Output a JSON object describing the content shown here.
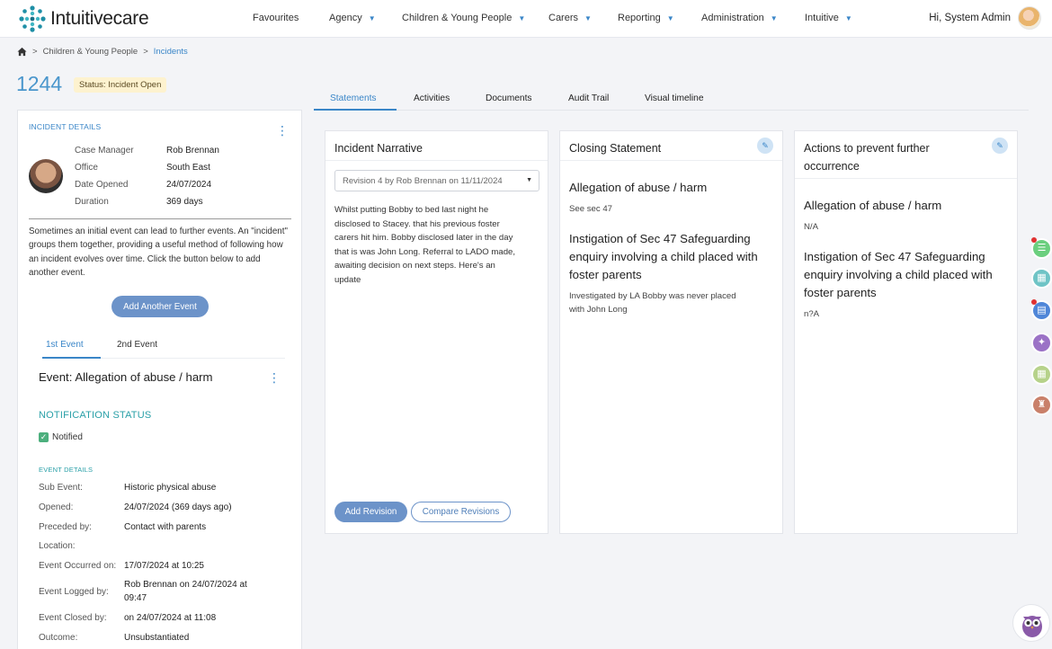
{
  "brand": {
    "name": "Intuitivecare"
  },
  "nav": [
    {
      "label": "Favourites",
      "has_menu": false
    },
    {
      "label": "Agency",
      "has_menu": true
    },
    {
      "label": "Children & Young People",
      "has_menu": true
    },
    {
      "label": "Carers",
      "has_menu": true
    },
    {
      "label": "Reporting",
      "has_menu": true
    },
    {
      "label": "Administration",
      "has_menu": true
    },
    {
      "label": "Intuitive",
      "has_menu": true
    }
  ],
  "user": {
    "greeting": "Hi, System Admin"
  },
  "breadcrumb": {
    "section": "Children & Young People",
    "current": "Incidents",
    "separator": ">"
  },
  "record": {
    "id": "1244",
    "status": "Status: Incident Open"
  },
  "incident_details": {
    "title": "INCIDENT DETAILS",
    "fields": [
      {
        "label": "Case Manager",
        "value": "Rob Brennan"
      },
      {
        "label": "Office",
        "value": "South East"
      },
      {
        "label": "Date Opened",
        "value": "24/07/2024"
      },
      {
        "label": "Duration",
        "value": "369 days"
      }
    ],
    "description": "Sometimes an initial event can lead to further events. An \"incident\" groups them together, providing a useful method of following how an incident evolves over time. Click the button below to add another event.",
    "add_event_label": "Add Another Event"
  },
  "event_tabs": [
    {
      "label": "1st Event",
      "active": true
    },
    {
      "label": "2nd Event",
      "active": false
    }
  ],
  "event": {
    "title": "Event: Allegation of abuse / harm",
    "notification_heading": "NOTIFICATION STATUS",
    "notified_label": "Notified",
    "notified": true,
    "details_heading": "EVENT DETAILS",
    "rows": [
      {
        "label": "Sub Event:",
        "value": "Historic physical abuse"
      },
      {
        "label": "Opened:",
        "value": "24/07/2024 (369 days ago)"
      },
      {
        "label": "Preceded by:",
        "value": "Contact with parents"
      },
      {
        "label": "Location:",
        "value": ""
      },
      {
        "label": "Event Occurred on:",
        "value": "17/07/2024 at 10:25"
      },
      {
        "label": "Event Logged by:",
        "value": "Rob Brennan on 24/07/2024 at",
        "value2": "09:47"
      },
      {
        "label": "Event Closed by:",
        "value": "on 24/07/2024 at 11:08"
      },
      {
        "label": "Outcome:",
        "value": "Unsubstantiated"
      }
    ]
  },
  "main_tabs": [
    {
      "label": "Statements",
      "active": true
    },
    {
      "label": "Activities",
      "active": false
    },
    {
      "label": "Documents",
      "active": false
    },
    {
      "label": "Audit Trail",
      "active": false
    },
    {
      "label": "Visual timeline",
      "active": false
    }
  ],
  "narrative": {
    "title": "Incident Narrative",
    "revision_selected": "Revision 4 by Rob Brennan on 11/11/2024",
    "lines": [
      "Whilst putting Bobby to bed last night he",
      "disclosed to Stacey. that his previous foster",
      "carers hit him.  Bobby disclosed later in the day",
      "that is was John Long. Referral to LADO made,",
      "awaiting decision on next steps. Here's an",
      "update"
    ],
    "add_revision_label": "Add Revision",
    "compare_label": "Compare Revisions"
  },
  "closing": {
    "title": "Closing Statement",
    "sections": [
      {
        "heading": [
          "Allegation of abuse / harm"
        ],
        "text": [
          "See sec 47"
        ]
      },
      {
        "heading": [
          "Instigation of Sec 47 Safeguarding",
          "enquiry involving a child placed with",
          "foster parents"
        ],
        "text": [
          "Investigated by LA Bobby was never placed",
          "with John Long"
        ]
      }
    ]
  },
  "actions": {
    "title_lines": [
      "Actions to prevent further",
      "occurrence"
    ],
    "sections": [
      {
        "heading": [
          "Allegation of abuse / harm"
        ],
        "text": [
          "N/A"
        ]
      },
      {
        "heading": [
          "Instigation of Sec 47 Safeguarding",
          "enquiry involving a child placed with",
          "foster parents"
        ],
        "text": [
          "n?A"
        ]
      }
    ]
  },
  "side_icons": [
    {
      "name": "list-icon",
      "glyph": "☰",
      "color": "#6bcf7e",
      "badge": true
    },
    {
      "name": "building-icon",
      "glyph": "▦",
      "color": "#6fc4c6",
      "badge": false
    },
    {
      "name": "document-icon",
      "glyph": "▤",
      "color": "#4f86d8",
      "badge": true
    },
    {
      "name": "person-icon",
      "glyph": "✦",
      "color": "#9b72c6",
      "badge": false
    },
    {
      "name": "calendar-icon",
      "glyph": "▦",
      "color": "#b6d28a",
      "badge": false
    },
    {
      "name": "stamp-icon",
      "glyph": "♜",
      "color": "#c9806a",
      "badge": false
    }
  ],
  "colors": {
    "accent": "#3a86c8",
    "button": "#6c93c9",
    "status_bg": "#fdf2cf",
    "teal": "#2aa0a8"
  }
}
